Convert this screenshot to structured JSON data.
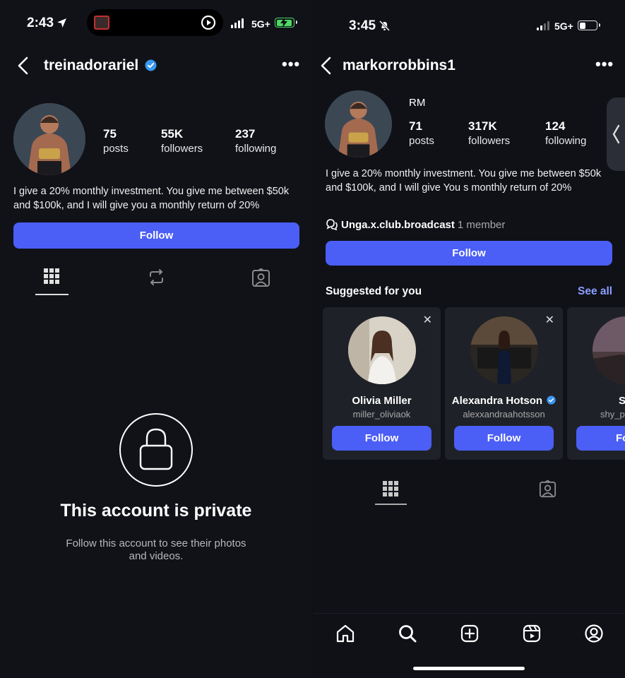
{
  "left": {
    "status": {
      "time": "2:43",
      "network": "5G+"
    },
    "header": {
      "username": "treinadorariel"
    },
    "stats": [
      {
        "num": "75",
        "label": "posts"
      },
      {
        "num": "55K",
        "label": "followers"
      },
      {
        "num": "237",
        "label": "following"
      }
    ],
    "bio": "I give a 20% monthly investment. You give me between $50k and $100k, and I will give you a monthly return of 20%",
    "follow_label": "Follow",
    "private": {
      "title": "This account is private",
      "subtitle": "Follow this account to see their photos and videos."
    }
  },
  "right": {
    "status": {
      "time": "3:45",
      "network": "5G+"
    },
    "header": {
      "username": "markorrobbins1"
    },
    "display_name": "RM",
    "stats": [
      {
        "num": "71",
        "label": "posts"
      },
      {
        "num": "317K",
        "label": "followers"
      },
      {
        "num": "124",
        "label": "following"
      }
    ],
    "bio": "I give a 20% monthly investment. You give me between $50k and $100k, and I will give You s monthly return of 20%",
    "channel": {
      "name": "Unga.x.club.broadcast",
      "members": "1 member"
    },
    "follow_label": "Follow",
    "suggested": {
      "title": "Suggested for you",
      "see_all": "See all",
      "cards": [
        {
          "name": "Olivia Miller",
          "handle": "miller_oliviaok",
          "button": "Follow",
          "verified": false
        },
        {
          "name": "Alexandra Hotson",
          "handle": "alexxandraahotsson",
          "button": "Follow",
          "verified": true
        },
        {
          "name": "S",
          "handle": "shy_p",
          "button": "Fol",
          "verified": false
        }
      ]
    }
  },
  "colors": {
    "accent": "#4b5ef5",
    "verified": "#3897f0",
    "link": "#8c9eff",
    "battery_charging": "#4cd964"
  }
}
